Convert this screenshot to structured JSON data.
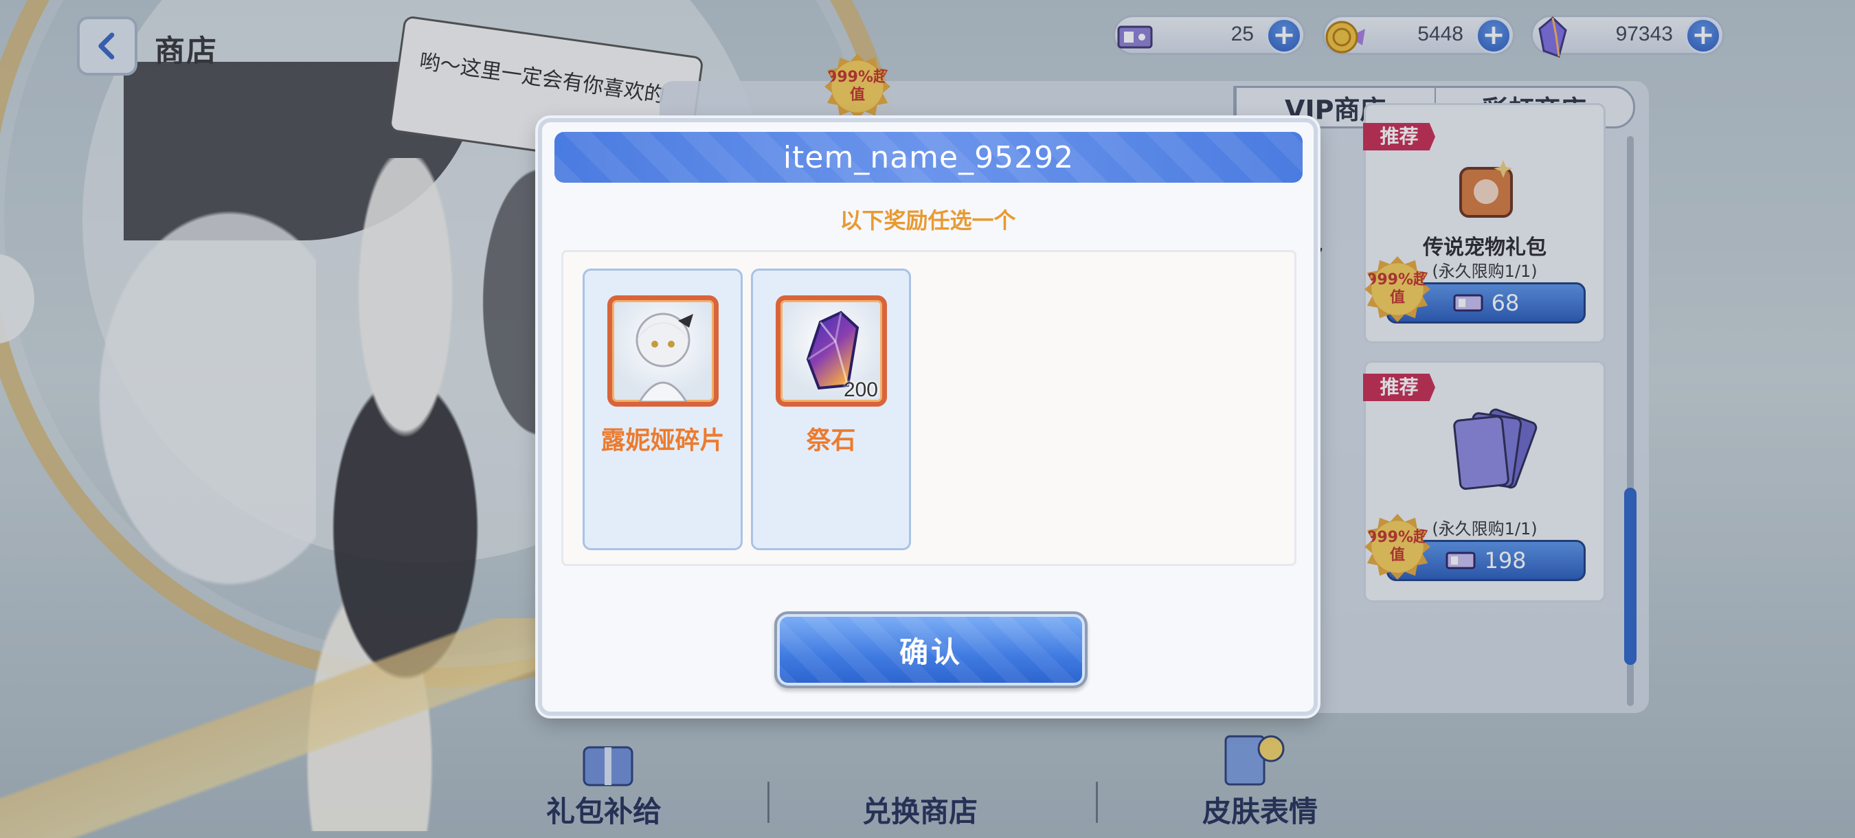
{
  "header": {
    "back_label": "back",
    "title": "商店"
  },
  "speech_bubble": {
    "text": "哟～这里一定会有你喜欢的"
  },
  "currencies": [
    {
      "icon": "ticket-icon",
      "value": "25"
    },
    {
      "icon": "gold-coin-icon",
      "value": "5448"
    },
    {
      "icon": "crystal-icon",
      "value": "97343"
    }
  ],
  "shop": {
    "tabs": [
      "VIP商店",
      "彩虹商店"
    ],
    "cards": [
      {
        "tag": "推荐",
        "title": "传说宠物礼包",
        "limit": "(永久限购1/1)",
        "price": "68",
        "badge": "999%超值"
      },
      {
        "tag": "推荐",
        "title": "",
        "limit": "(永久限购1/1)",
        "price": "198",
        "badge": "999%超值"
      }
    ],
    "left_card_partial": "包",
    "top_badge": "999%超值"
  },
  "bottom_nav": [
    "礼包补给",
    "兑换商店",
    "皮肤表情"
  ],
  "modal": {
    "title": "item_name_95292",
    "subtitle": "以下奖励任选一个",
    "rewards": [
      {
        "name": "露妮娅碎片",
        "icon": "character-portrait-icon",
        "qty": ""
      },
      {
        "name": "祭石",
        "icon": "crystal-gem-icon",
        "qty": "200"
      }
    ],
    "confirm_label": "确认"
  },
  "colors": {
    "accent_blue": "#4a7be0",
    "reward_name_orange": "#ec7b2f",
    "subtitle_orange": "#e89a33",
    "tag_red": "#c72d52"
  }
}
